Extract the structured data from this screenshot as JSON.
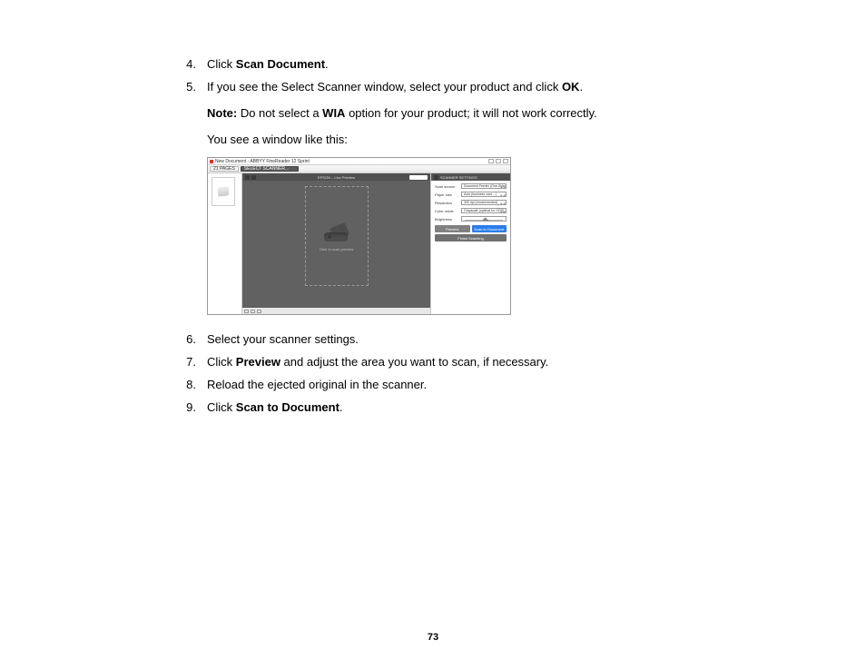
{
  "page_number": "73",
  "steps": {
    "s4": {
      "num": "4.",
      "pre": "Click ",
      "bold": "Scan Document",
      "post": "."
    },
    "s5": {
      "num": "5.",
      "pre": "If you see the Select Scanner window, select your product and click ",
      "bold": "OK",
      "post": "."
    },
    "note": {
      "label": "Note:",
      "pre": " Do not select a ",
      "bold": "WIA",
      "post": " option for your product; it will not work correctly."
    },
    "lead": "You see a window like this:",
    "s6": {
      "num": "6.",
      "text": "Select your scanner settings."
    },
    "s7": {
      "num": "7.",
      "pre": "Click ",
      "bold": "Preview",
      "post": " and adjust the area you want to scan, if necessary."
    },
    "s8": {
      "num": "8.",
      "text": "Reload the ejected original in the scanner."
    },
    "s9": {
      "num": "9.",
      "pre": "Click ",
      "bold": "Scan to Document",
      "post": "."
    }
  },
  "screenshot": {
    "title": "New Document - ABBYY FineReader 12 Sprint",
    "toolbar": {
      "pages": "21 PAGES",
      "scan": "SELECT SCANNER..."
    },
    "center": {
      "title": "EPSON – Live Preview",
      "hint": "Click to scan preview"
    },
    "right": {
      "title": "SCANNER SETTINGS",
      "rows": {
        "scan_source": {
          "label": "Scan source",
          "value": "Document Feeder (One-Sided)"
        },
        "paper_size": {
          "label": "Paper size",
          "value": "Auto (business card ...)"
        },
        "resolution": {
          "label": "Resolution",
          "value": "300 dpi (recommended)"
        },
        "color_mode": {
          "label": "Color mode",
          "value": "Grayscale (optimal for OCR)"
        },
        "brightness": {
          "label": "Brightness"
        }
      },
      "buttons": {
        "preview": "Preview",
        "scan": "Scan to Document",
        "finish": "Finish Scanning"
      }
    }
  }
}
